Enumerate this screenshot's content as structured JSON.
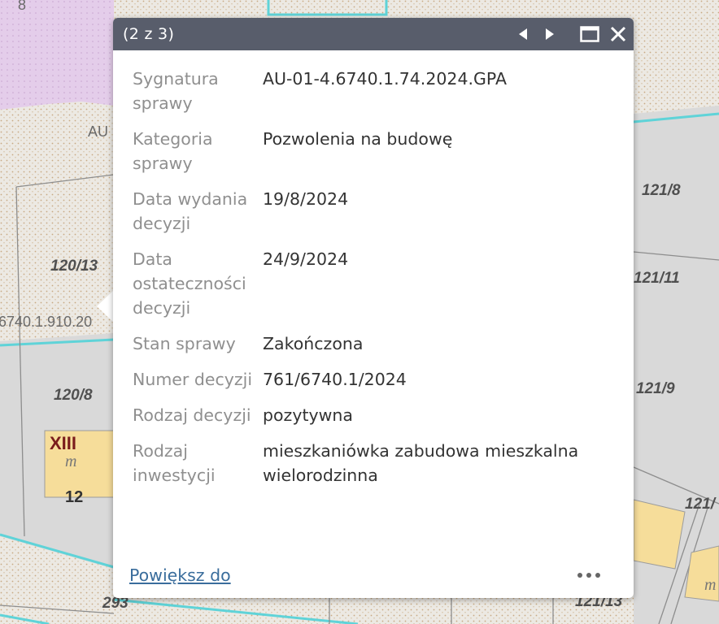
{
  "map": {
    "plot_labels": [
      "8",
      "AU",
      "121/8",
      "120/13",
      "121/11",
      "6740.1.910.20",
      "120/8",
      "121/9",
      "XIII",
      "m",
      "12",
      "121/",
      "293",
      "121/13",
      "m"
    ]
  },
  "popup": {
    "title": "(2 z 3)",
    "icons": {
      "prev": "triangle-left-icon",
      "next": "triangle-right-icon",
      "maximize": "maximize-icon",
      "close": "close-icon",
      "more": "ellipsis-icon"
    },
    "fields": [
      {
        "label": "Sygnatura sprawy",
        "value": "AU-01-4.6740.1.74.2024.GPA"
      },
      {
        "label": "Kategoria sprawy",
        "value": "Pozwolenia na budowę"
      },
      {
        "label": "Data wydania decyzji",
        "value": "19/8/2024"
      },
      {
        "label": "Data ostateczności decyzji",
        "value": "24/9/2024"
      },
      {
        "label": "Stan sprawy",
        "value": "Zakończona"
      },
      {
        "label": "Numer decyzji",
        "value": "761/6740.1/2024"
      },
      {
        "label": "Rodzaj decyzji",
        "value": "pozytywna"
      },
      {
        "label": "Rodzaj inwestycji",
        "value": "mieszkaniówka zabudowa mieszkalna wielorodzinna"
      }
    ],
    "zoom_link": "Powiększ do"
  },
  "colors": {
    "header": "#585d6b",
    "parcel_line": "#5fd3d8",
    "parcel_fill": "#d9d9d9",
    "purple_zone": "#e2c8ea",
    "building": "#f6dd9a"
  }
}
